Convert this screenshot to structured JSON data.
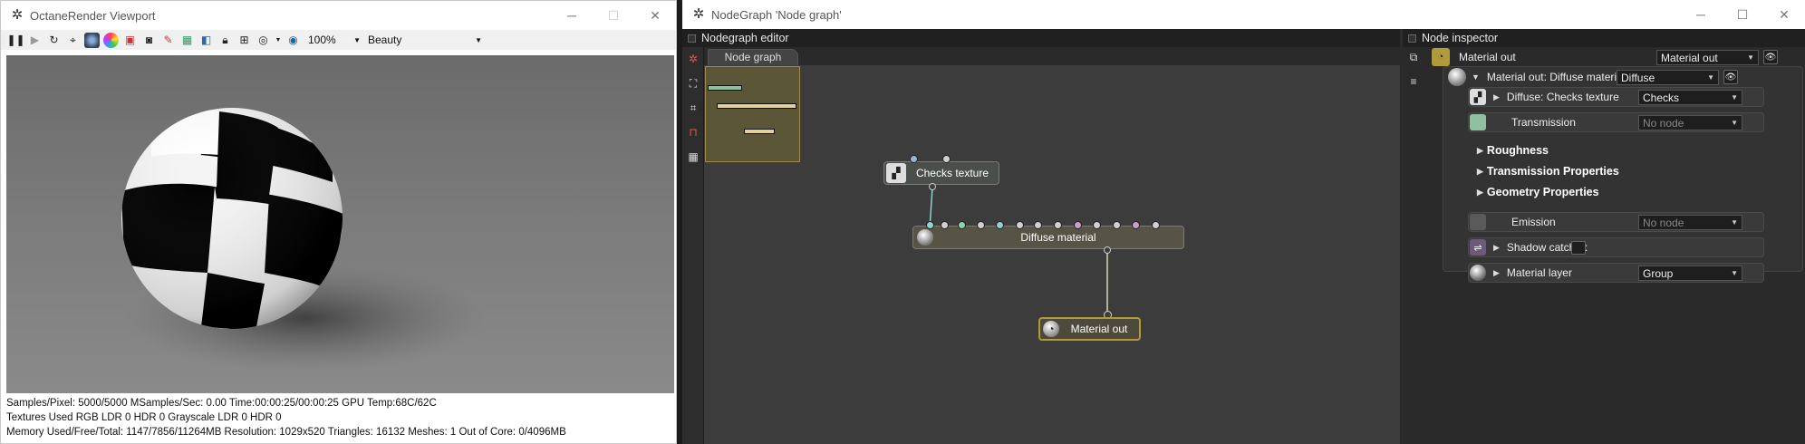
{
  "viewport": {
    "title": "OctaneRender Viewport",
    "toolbar": {
      "zoom": "100%",
      "pass": "Beauty"
    },
    "status": [
      "Samples/Pixel: 5000/5000   MSamples/Sec: 0.00   Time:00:00:25/00:00:25   GPU Temp:68C/62C",
      "Textures Used RGB LDR 0   HDR 0   Grayscale LDR 0   HDR 0",
      "Memory Used/Free/Total: 1147/7856/11264MB   Resolution: 1029x520   Triangles: 16132   Meshes: 1 Out of Core: 0/4096MB"
    ]
  },
  "nodegraph": {
    "title": "NodeGraph 'Node graph'",
    "panel_title": "Nodegraph editor",
    "tab": "Node graph",
    "nodes": {
      "checks": "Checks texture",
      "diffuse": "Diffuse material",
      "out": "Material out"
    },
    "colors": {
      "canvas": "#3c3c3c",
      "wire": "#d9d6b8",
      "minimap_bg": "#5c5639",
      "material_out_border": "#b09a3a"
    }
  },
  "inspector": {
    "panel_title": "Node inspector",
    "root": {
      "label": "Material out",
      "value": "Material out"
    },
    "material": {
      "label": "Material out: Diffuse material",
      "value": "Diffuse"
    },
    "rows": {
      "diffuse": {
        "label": "Diffuse: Checks texture",
        "value": "Checks"
      },
      "transmission": {
        "label": "Transmission",
        "value": "No node"
      },
      "roughness": "Roughness",
      "transmission_props": "Transmission Properties",
      "geometry_props": "Geometry Properties",
      "emission": {
        "label": "Emission",
        "value": "No node"
      },
      "shadow": {
        "label": "Shadow catcher:"
      },
      "layer": {
        "label": "Material layer",
        "value": "Group"
      }
    }
  }
}
